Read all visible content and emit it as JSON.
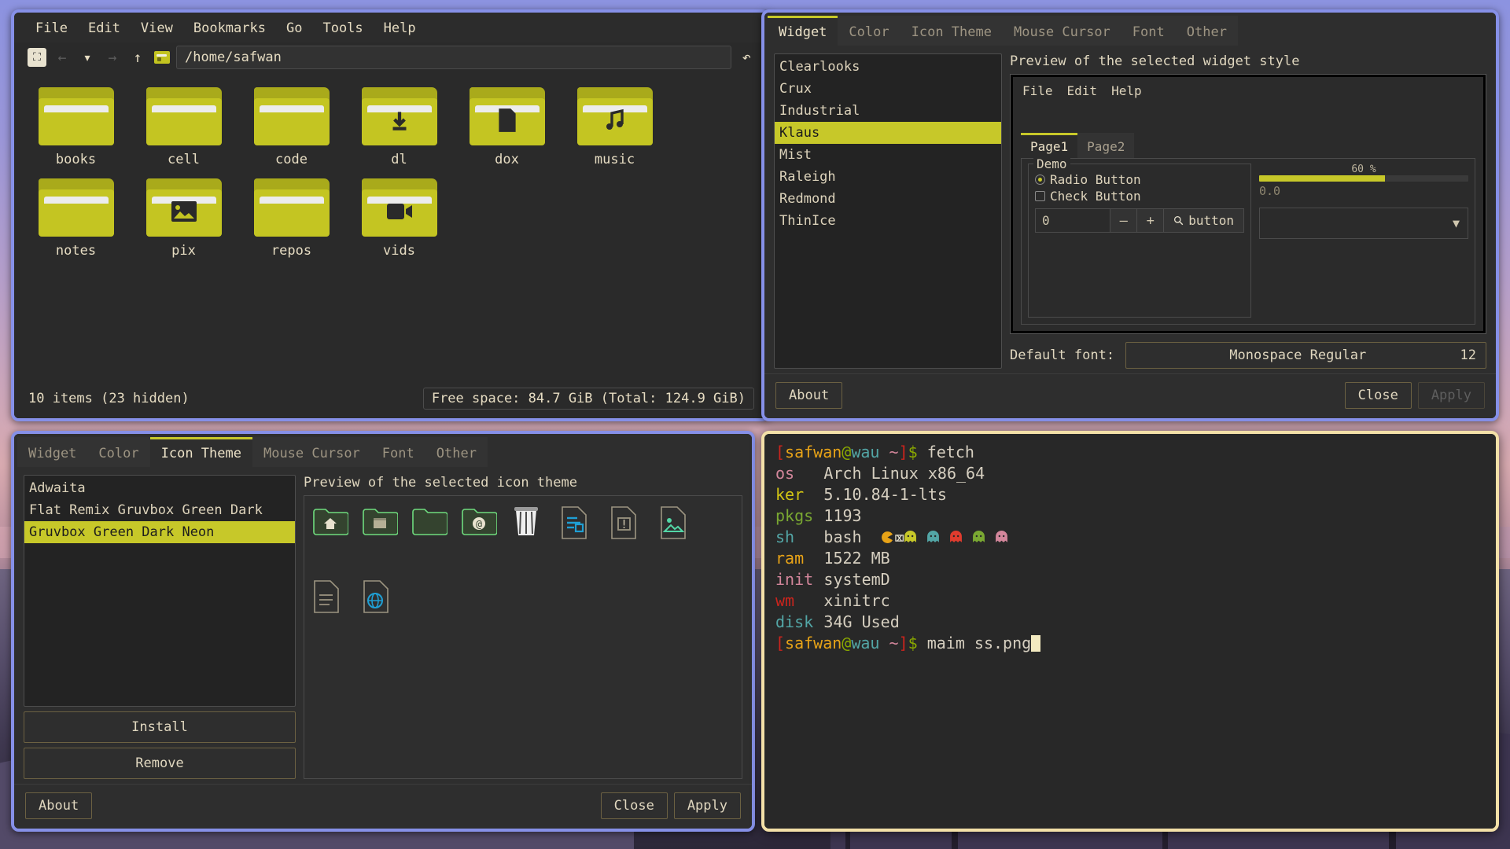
{
  "desktop": {
    "wallpaper_description": "dusk landscape"
  },
  "file_manager": {
    "menu": [
      "File",
      "Edit",
      "View",
      "Bookmarks",
      "Go",
      "Tools",
      "Help"
    ],
    "toolbar": {
      "home_icon": "home-icon",
      "back_icon": "arrow-left-icon",
      "history_icon": "chevron-down-icon",
      "forward_icon": "arrow-right-icon",
      "up_icon": "arrow-up-icon",
      "location_folder_icon": "folder-icon",
      "reload_icon": "reload-icon",
      "path": "/home/safwan"
    },
    "items": [
      {
        "name": "books",
        "icon": "folder-icon"
      },
      {
        "name": "cell",
        "icon": "folder-icon"
      },
      {
        "name": "code",
        "icon": "folder-icon"
      },
      {
        "name": "dl",
        "icon": "folder-download-icon"
      },
      {
        "name": "dox",
        "icon": "folder-document-icon"
      },
      {
        "name": "music",
        "icon": "folder-music-icon"
      },
      {
        "name": "notes",
        "icon": "folder-icon"
      },
      {
        "name": "pix",
        "icon": "folder-image-icon"
      },
      {
        "name": "repos",
        "icon": "folder-icon"
      },
      {
        "name": "vids",
        "icon": "folder-video-icon"
      }
    ],
    "status": {
      "count": "10 items (23 hidden)",
      "free_space": "Free space: 84.7 GiB (Total: 124.9 GiB)"
    }
  },
  "widget_dialog": {
    "tabs": [
      {
        "label": "Widget",
        "active": true
      },
      {
        "label": "Color",
        "active": false
      },
      {
        "label": "Icon Theme",
        "active": false
      },
      {
        "label": "Mouse Cursor",
        "active": false
      },
      {
        "label": "Font",
        "active": false
      },
      {
        "label": "Other",
        "active": false
      }
    ],
    "styles": [
      {
        "label": "Clearlooks",
        "selected": false
      },
      {
        "label": "Crux",
        "selected": false
      },
      {
        "label": "Industrial",
        "selected": false
      },
      {
        "label": "Klaus",
        "selected": true
      },
      {
        "label": "Mist",
        "selected": false
      },
      {
        "label": "Raleigh",
        "selected": false
      },
      {
        "label": "Redmond",
        "selected": false
      },
      {
        "label": "ThinIce",
        "selected": false
      }
    ],
    "preview_title": "Preview of the selected widget style",
    "preview": {
      "menu": [
        "File",
        "Edit",
        "Help"
      ],
      "tabs": [
        {
          "label": "Page1",
          "active": true
        },
        {
          "label": "Page2",
          "active": false
        }
      ],
      "group_title": "Demo",
      "radio_label": "Radio Button",
      "check_label": "Check Button",
      "spin_value": "0",
      "spin_minus": "–",
      "spin_plus": "+",
      "button_label": "button",
      "button_icon": "search-icon",
      "progress_label": "60 %",
      "progress_value": 60,
      "slider_value": "0.0",
      "combo_value": "",
      "combo_icon": "chevron-down-icon"
    },
    "font": {
      "label": "Default font:",
      "name": "Monospace Regular",
      "size": "12"
    },
    "buttons": {
      "about": "About",
      "close": "Close",
      "apply": "Apply",
      "apply_disabled": true
    }
  },
  "icon_dialog": {
    "tabs": [
      {
        "label": "Widget",
        "active": false
      },
      {
        "label": "Color",
        "active": false
      },
      {
        "label": "Icon Theme",
        "active": true
      },
      {
        "label": "Mouse Cursor",
        "active": false
      },
      {
        "label": "Font",
        "active": false
      },
      {
        "label": "Other",
        "active": false
      }
    ],
    "themes": [
      {
        "label": "Adwaita",
        "selected": false
      },
      {
        "label": "Flat Remix Gruvbox Green Dark",
        "selected": false
      },
      {
        "label": "Gruvbox Green Dark Neon",
        "selected": true
      }
    ],
    "preview_title": "Preview of the selected icon theme",
    "preview_icons": [
      "folder-home-icon",
      "folder-documents-icon",
      "folder-plain-icon",
      "folder-network-icon",
      "trash-icon",
      "file-text-blue-icon",
      "file-warning-icon",
      "file-image-icon",
      "file-document-icon",
      "file-web-icon"
    ],
    "side_buttons": {
      "install": "Install",
      "remove": "Remove"
    },
    "buttons": {
      "about": "About",
      "close": "Close",
      "apply": "Apply",
      "apply_disabled": false
    }
  },
  "terminal": {
    "prompt": {
      "user": "safwan",
      "host": "wau",
      "cwd": "~"
    },
    "command_1": "fetch",
    "fetch": [
      {
        "key": "os",
        "value": "Arch Linux x86_64",
        "color": "#d3869b"
      },
      {
        "key": "ker",
        "value": "5.10.84-1-lts",
        "color": "#d2c413"
      },
      {
        "key": "pkgs",
        "value": "1193",
        "color": "#7aa832"
      },
      {
        "key": "sh",
        "value": "bash",
        "color": "#53a6a6"
      },
      {
        "key": "ram",
        "value": "1522 MB",
        "color": "#e8a317"
      },
      {
        "key": "init",
        "value": "systemD",
        "color": "#d3869b"
      },
      {
        "key": "wm",
        "value": "xinitrc",
        "color": "#cc241d"
      },
      {
        "key": "disk",
        "value": "34G Used",
        "color": "#53a6a6"
      }
    ],
    "palette_row": {
      "pacman_icon": "pacman-icon",
      "pacman_color": "#e8a317",
      "ghosts": [
        "#c7c829",
        "#53a6a6",
        "#e03c2e",
        "#7aa832",
        "#d3869b"
      ]
    },
    "command_2": "maim ss.png",
    "cursor": "block-cursor",
    "mouse_cursor": "ibeam-cursor"
  }
}
